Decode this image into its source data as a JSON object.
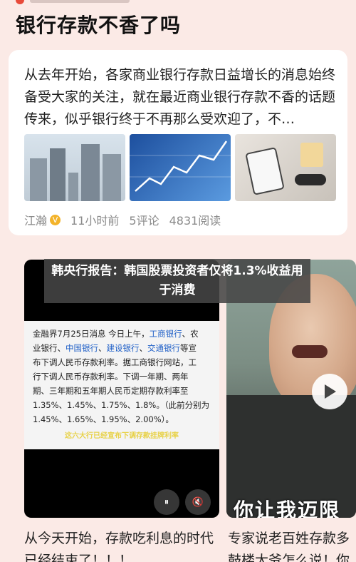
{
  "header": {
    "title": "银行存款不香了吗"
  },
  "article_card": {
    "text": "从去年开始，各家商业银行存款日益增长的消息始终备受大家的关注，就在最近商业银行存款不香的话题传来，似乎银行终于不再那么受欢迎了，不…",
    "author": "江瀚",
    "time": "11小时前",
    "comments": "5评论",
    "reads": "4831阅读"
  },
  "popup": {
    "text": "韩央行报告：韩国股票投资者仅将1.3%收益用于消费"
  },
  "video_left": {
    "doc_lines": [
      {
        "parts": [
          {
            "t": "金融界7月25日消息 今日上午，",
            "c": ""
          },
          {
            "t": "工商银行",
            "c": "blue"
          },
          {
            "t": "、农",
            "c": ""
          }
        ]
      },
      {
        "parts": [
          {
            "t": "业银行、",
            "c": ""
          },
          {
            "t": "中国银行",
            "c": "blue"
          },
          {
            "t": "、",
            "c": ""
          },
          {
            "t": "建设银行",
            "c": "blue"
          },
          {
            "t": "、",
            "c": ""
          },
          {
            "t": "交通银行",
            "c": "blue"
          },
          {
            "t": "等宣",
            "c": ""
          }
        ]
      },
      {
        "parts": [
          {
            "t": "布下调人民币存款利率。据工商银行网站，工",
            "c": ""
          }
        ]
      },
      {
        "parts": [
          {
            "t": "行下调人民币存款利率。下调一年期、两年",
            "c": ""
          }
        ]
      },
      {
        "parts": [
          {
            "t": "期、三年期和五年期人民币定期存款利率至",
            "c": ""
          }
        ]
      },
      {
        "parts": [
          {
            "t": "1.35%、1.45%、1.75%、1.8%。（此前分别为",
            "c": ""
          }
        ]
      },
      {
        "parts": [
          {
            "t": "1.45%、1.65%、1.95%、2.00%）。",
            "c": ""
          }
        ]
      }
    ],
    "caption": "这六大行已经宣布下调存款挂牌利率",
    "pause_label": "⏸",
    "mute_label": "🔇",
    "title": "从今天开始，存款吃利息的时代已经结束了！！！"
  },
  "video_right": {
    "overlay": "你让我迈限",
    "title": "专家说老百姓存款多鼓楼大爷怎么说！你"
  },
  "colors": {
    "background": "#fbeae6",
    "card": "#ffffff",
    "link_blue": "#1f5fc7",
    "caption_yellow": "#e8d24a",
    "verify_badge": "#f3b32a"
  }
}
